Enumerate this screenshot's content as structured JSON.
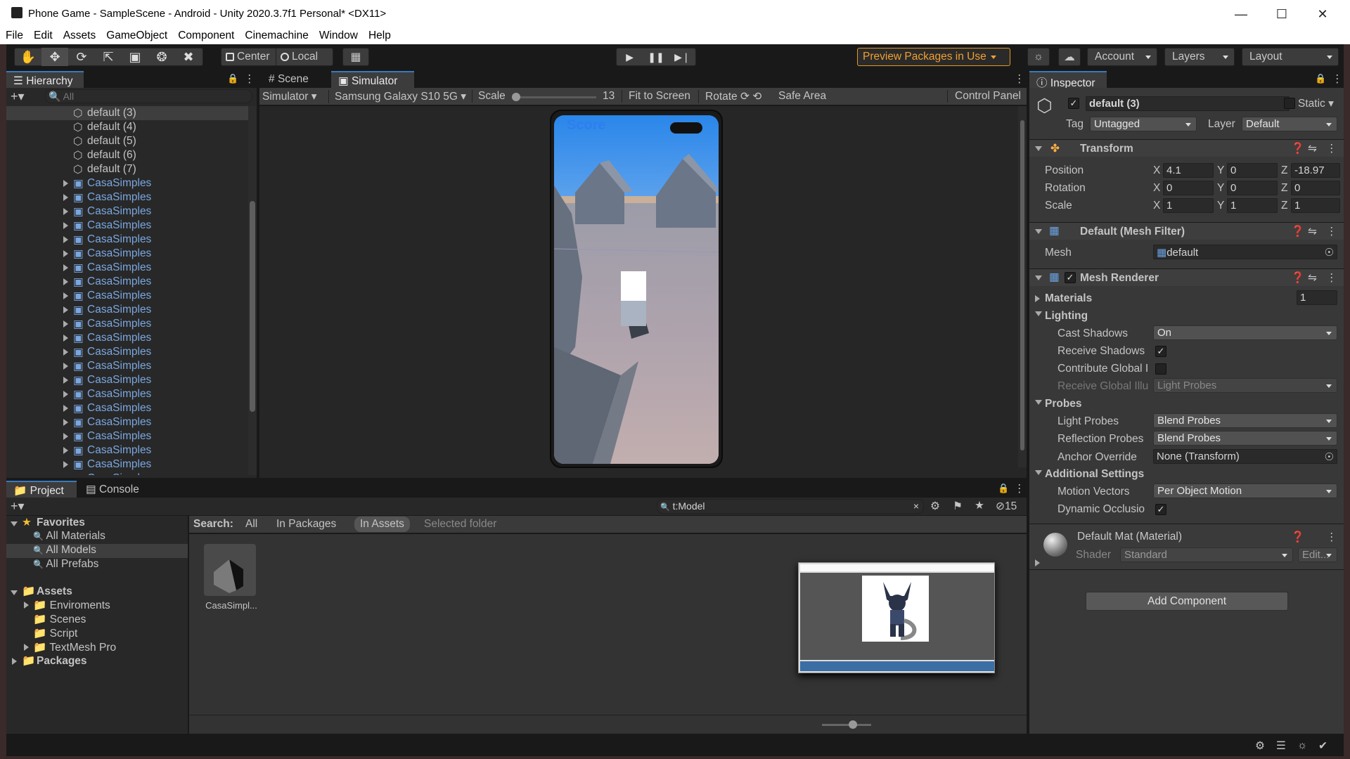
{
  "window": {
    "title": "Phone Game - SampleScene - Android - Unity 2020.3.7f1 Personal* <DX11>"
  },
  "menu": [
    "File",
    "Edit",
    "Assets",
    "GameObject",
    "Component",
    "Cinemachine",
    "Window",
    "Help"
  ],
  "toolbar": {
    "pivot_label": "Center",
    "space_label": "Local",
    "preview_packages_label": "Preview Packages in Use",
    "account_label": "Account",
    "layers_label": "Layers",
    "layout_label": "Layout"
  },
  "hierarchy": {
    "tab_label": "Hierarchy",
    "search_placeholder": "All",
    "items": [
      {
        "label": "default (3)"
      },
      {
        "label": "default (4)"
      },
      {
        "label": "default (5)"
      },
      {
        "label": "default (6)"
      },
      {
        "label": "default (7)"
      },
      {
        "label": "CasaSimples"
      },
      {
        "label": "CasaSimples"
      },
      {
        "label": "CasaSimples"
      },
      {
        "label": "CasaSimples"
      },
      {
        "label": "CasaSimples"
      },
      {
        "label": "CasaSimples"
      },
      {
        "label": "CasaSimples"
      },
      {
        "label": "CasaSimples"
      },
      {
        "label": "CasaSimples"
      },
      {
        "label": "CasaSimples"
      },
      {
        "label": "CasaSimples"
      },
      {
        "label": "CasaSimples"
      },
      {
        "label": "CasaSimples"
      },
      {
        "label": "CasaSimples"
      },
      {
        "label": "CasaSimples"
      },
      {
        "label": "CasaSimples"
      },
      {
        "label": "CasaSimples"
      },
      {
        "label": "CasaSimples"
      },
      {
        "label": "CasaSimples"
      },
      {
        "label": "CasaSimples"
      },
      {
        "label": "CasaSimples"
      },
      {
        "label": "CasaSimples"
      }
    ]
  },
  "simulator": {
    "scene_tab": "Scene",
    "simulator_tab": "Simulator",
    "mode_label": "Simulator",
    "device_label": "Samsung Galaxy S10 5G",
    "scale_label": "Scale",
    "scale_value": "13",
    "scale_fraction": 0.0,
    "fit_label": "Fit to Screen",
    "rotate_label": "Rotate",
    "safe_area_label": "Safe Area",
    "control_panel_label": "Control Panel",
    "game_score_label": "Score"
  },
  "project": {
    "project_tab": "Project",
    "console_tab": "Console",
    "search_value": "t:Model",
    "hidden_count": "15",
    "search_scope": {
      "label": "Search:",
      "options": [
        "All",
        "In Packages",
        "In Assets",
        "Selected folder"
      ],
      "active": "In Assets"
    },
    "favorites": {
      "label": "Favorites",
      "items": [
        "All Materials",
        "All Models",
        "All Prefabs"
      ]
    },
    "assets": {
      "label": "Assets",
      "items": [
        "Enviroments",
        "Scenes",
        "Script",
        "TextMesh Pro"
      ]
    },
    "packages_label": "Packages",
    "asset_tile_label": "CasaSimpl..."
  },
  "inspector": {
    "tab_label": "Inspector",
    "object_name": "default (3)",
    "static_label": "Static",
    "tag_label": "Tag",
    "tag_value": "Untagged",
    "layer_label": "Layer",
    "layer_value": "Default",
    "transform": {
      "title": "Transform",
      "rows": [
        {
          "label": "Position",
          "x": "4.1",
          "y": "0",
          "z": "-18.97"
        },
        {
          "label": "Rotation",
          "x": "0",
          "y": "0",
          "z": "0"
        },
        {
          "label": "Scale",
          "x": "1",
          "y": "1",
          "z": "1"
        }
      ]
    },
    "mesh_filter": {
      "title": "Default (Mesh Filter)",
      "mesh_label": "Mesh",
      "mesh_value": "default"
    },
    "mesh_renderer": {
      "title": "Mesh Renderer",
      "materials_label": "Materials",
      "materials_count": "1",
      "lighting_label": "Lighting",
      "cast_shadows_label": "Cast Shadows",
      "cast_shadows_value": "On",
      "receive_shadows_label": "Receive Shadows",
      "contribute_gi_label": "Contribute Global I",
      "receive_gi_label": "Receive Global Illu",
      "receive_gi_value": "Light Probes",
      "probes_label": "Probes",
      "light_probes_label": "Light Probes",
      "light_probes_value": "Blend Probes",
      "reflection_probes_label": "Reflection Probes",
      "reflection_probes_value": "Blend Probes",
      "anchor_override_label": "Anchor Override",
      "anchor_override_value": "None (Transform)",
      "additional_label": "Additional Settings",
      "motion_vectors_label": "Motion Vectors",
      "motion_vectors_value": "Per Object Motion",
      "dynamic_occlusion_label": "Dynamic Occlusio"
    },
    "material": {
      "title": "Default Mat (Material)",
      "shader_label": "Shader",
      "shader_value": "Standard",
      "edit_label": "Edit..."
    },
    "add_component_label": "Add Component"
  },
  "colors": {
    "accent_blue": "#3a79bb",
    "prefab_blue": "#7aa7e0",
    "preview_orange": "#f0a030",
    "score_blue": "#2d7ff0"
  },
  "icons": [
    "hand-tool-icon",
    "move-tool-icon",
    "rotate-tool-icon",
    "scale-tool-icon",
    "rect-tool-icon",
    "transform-tool-icon",
    "custom-tool-icon",
    "play-icon",
    "pause-icon",
    "step-icon",
    "lock-icon",
    "kebab-menu-icon",
    "cloud-icon",
    "star-icon",
    "folder-icon"
  ]
}
